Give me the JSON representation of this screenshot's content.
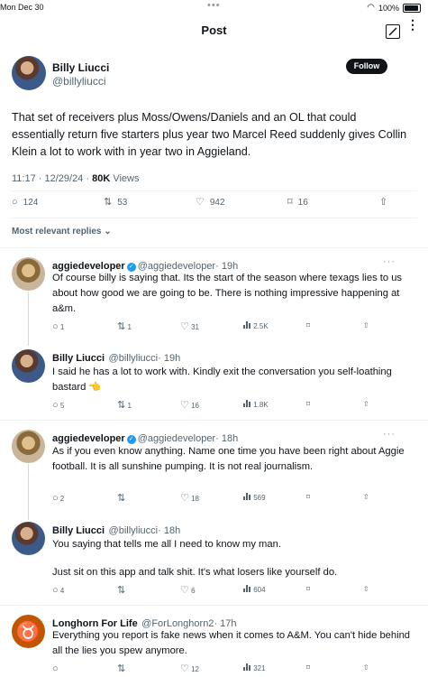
{
  "status_bar": {
    "time": "Mon Dec 30",
    "dots": "•••",
    "battery": "100%"
  },
  "header": {
    "title": "Post"
  },
  "post": {
    "name": "Billy Liucci",
    "handle": "@billyliucci",
    "follow_label": "Follow",
    "text": "That set of receivers plus Moss/Owens/Daniels and an OL that could essentially return five starters plus year two Marcel Reed suddenly gives Collin Klein a lot to work with in year two in Aggieland.",
    "time": "11:17 · 12/29/24 · ",
    "views_count": "80K",
    "views_label": " Views",
    "replies": "124",
    "reposts": "53",
    "likes": "942",
    "bookmarks": "16"
  },
  "replies_filter": "Most relevant replies",
  "replies": [
    {
      "name": "aggiedeveloper",
      "handle": "@aggiedeveloper",
      "age": "· 19h",
      "text": "Of course billy is saying that. Its the start of the season where texags lies to us about how good we are going to be. There is nothing impressive happening at a&m.",
      "replies": "1",
      "reposts": "1",
      "likes": "31",
      "views": "2.5K"
    },
    {
      "name": "Billy Liucci",
      "handle": "@billyliucci",
      "age": "· 19h",
      "text": "I said he has a lot to work with. Kindly exit the conversation you self-loathing bastard 👈",
      "replies": "5",
      "reposts": "1",
      "likes": "16",
      "views": "1.8K"
    },
    {
      "name": "aggiedeveloper",
      "handle": "@aggiedeveloper",
      "age": "· 18h",
      "text": "As if you even know anything. Name one time you have been right about Aggie football.  It is all sunshine pumping. It is not real journalism.",
      "replies": "2",
      "reposts": "",
      "likes": "18",
      "views": "569"
    },
    {
      "name": "Billy Liucci",
      "handle": "@billyliucci",
      "age": "· 18h",
      "text": "You saying that tells me all I need to know my man.",
      "text2": "Just sit on this app and talk shit. It's what losers like yourself do.",
      "replies": "4",
      "reposts": "",
      "likes": "6",
      "views": "604"
    },
    {
      "name": "Longhorn For Life",
      "handle": "@ForLonghorn2",
      "age": "· 17h",
      "text": "Everything you report is fake news when it comes to A&M. You can't hide behind all the lies you spew anymore.",
      "replies": "",
      "reposts": "",
      "likes": "12",
      "views": "321"
    }
  ]
}
